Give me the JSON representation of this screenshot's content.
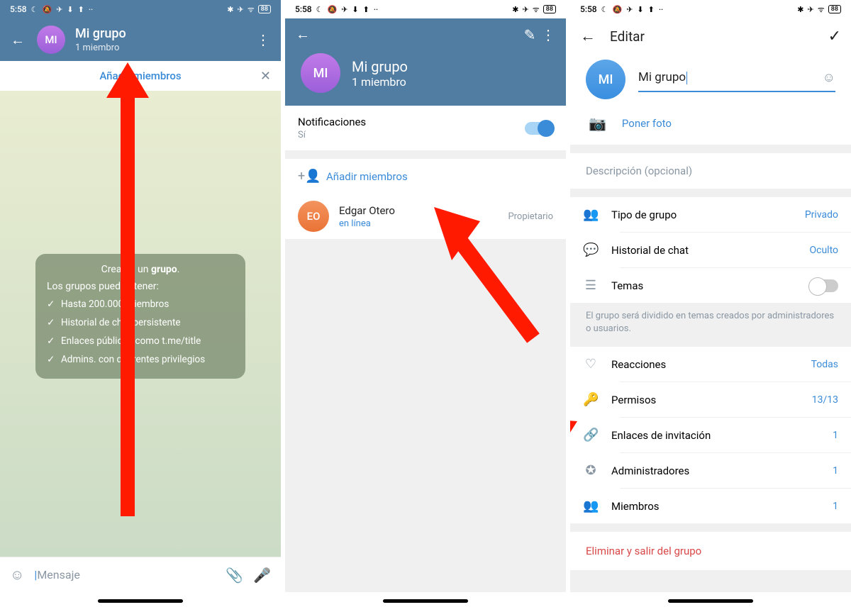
{
  "status": {
    "time": "5:58",
    "right_icons": "✱ ✈ ᯤ",
    "battery": "88"
  },
  "screen1": {
    "header": {
      "title": "Mi grupo",
      "subtitle": "1 miembro",
      "avatar": "MI"
    },
    "add_banner": "Añadir miembros",
    "tip": {
      "title_a": "Creaste un ",
      "title_b": "grupo",
      "subtitle": "Los grupos pueden tener:",
      "items": [
        "Hasta 200.000 miembros",
        "Historial de chat persistente",
        "Enlaces públicos como t.me/title",
        "Admins. con diferentes privilegios"
      ]
    },
    "msg_placeholder": "Mensaje"
  },
  "screen2": {
    "header": {
      "title": "Mi grupo",
      "subtitle": "1 miembro",
      "avatar": "MI"
    },
    "notif_label": "Notificaciones",
    "notif_value": "Sí",
    "add_members": "Añadir miembros",
    "member": {
      "initials": "EO",
      "name": "Edgar Otero",
      "status": "en línea",
      "role": "Propietario"
    }
  },
  "screen3": {
    "edit_title": "Editar",
    "avatar": "MI",
    "name_value": "Mi grupo",
    "put_photo": "Poner foto",
    "description_placeholder": "Descripción (opcional)",
    "rows": {
      "type": {
        "label": "Tipo de grupo",
        "value": "Privado"
      },
      "history": {
        "label": "Historial de chat",
        "value": "Oculto"
      },
      "topics": {
        "label": "Temas"
      }
    },
    "topics_hint": "El grupo será dividido en temas creados por administradores o usuarios.",
    "rows2": {
      "reactions": {
        "label": "Reacciones",
        "value": "Todas"
      },
      "permissions": {
        "label": "Permisos",
        "value": "13/13"
      },
      "invites": {
        "label": "Enlaces de invitación",
        "value": "1"
      },
      "admins": {
        "label": "Administradores",
        "value": "1"
      },
      "members": {
        "label": "Miembros",
        "value": "1"
      }
    },
    "delete": "Eliminar y salir del grupo"
  }
}
